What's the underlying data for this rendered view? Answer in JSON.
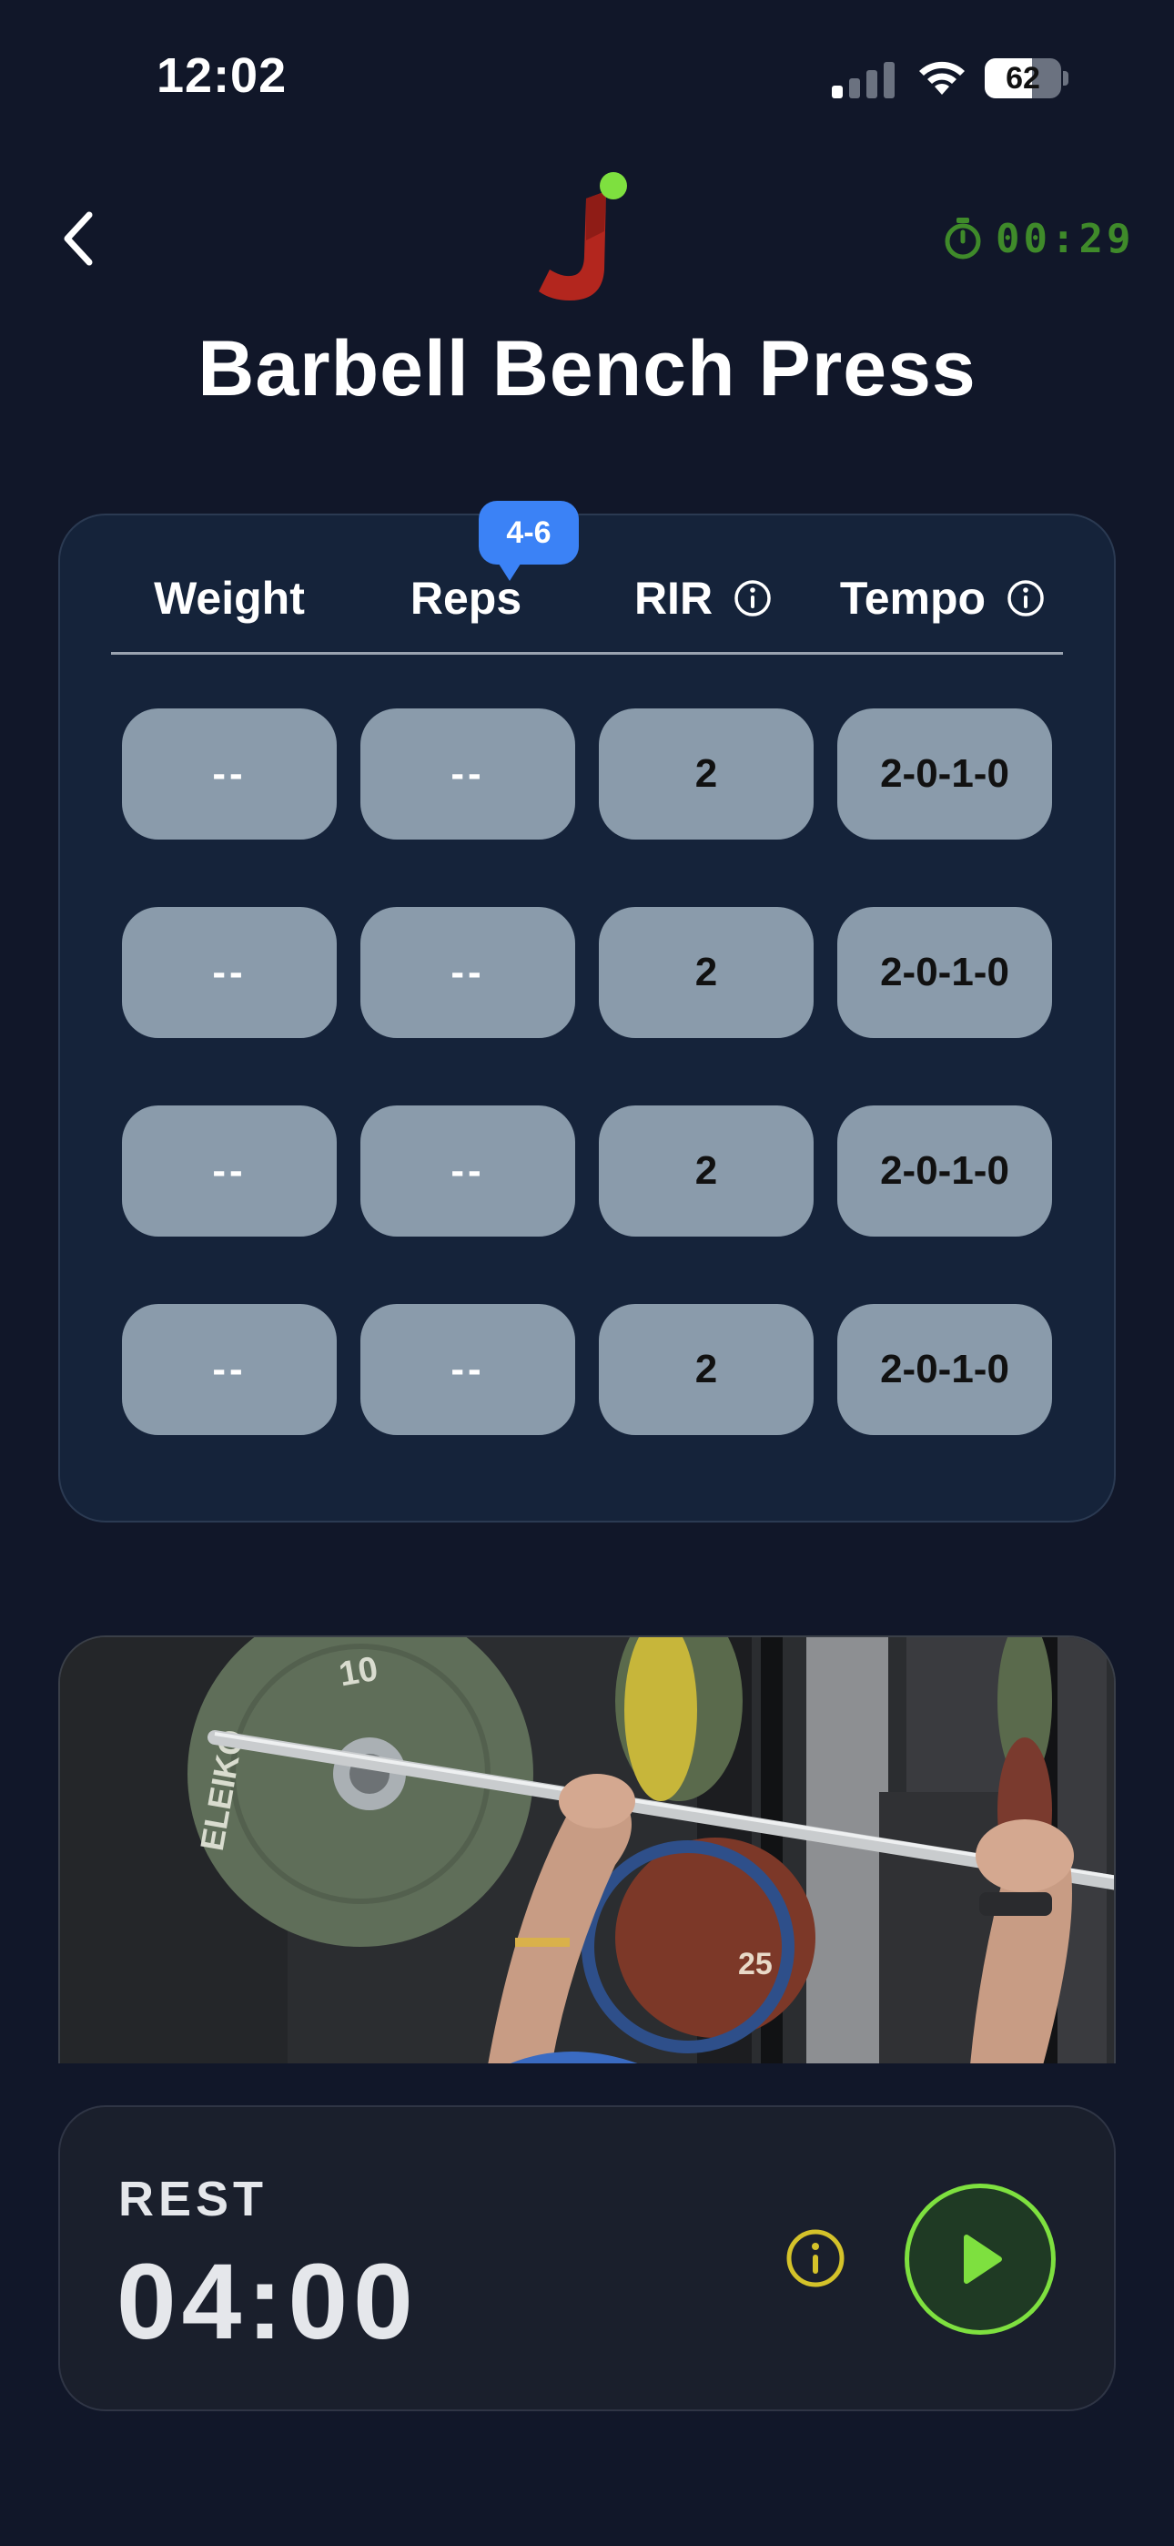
{
  "status_bar": {
    "time": "12:02",
    "battery_percent": "62",
    "battery_level": 0.62,
    "signal_bars_active": 1,
    "signal_bars_total": 4
  },
  "header": {
    "back_icon": "chevron-left-icon",
    "logo_icon": "app-logo-icon",
    "timer_icon": "stopwatch-icon",
    "timer_value": "00:29",
    "timer_color": "#3f8a2a",
    "title": "Barbell Bench Press"
  },
  "sets_table": {
    "columns": [
      {
        "label": "Weight",
        "info": false
      },
      {
        "label": "Reps",
        "info": false
      },
      {
        "label": "RIR",
        "info": true
      },
      {
        "label": "Tempo",
        "info": true
      }
    ],
    "reps_target_badge": "4-6",
    "badge_color": "#3b82f6",
    "rows": [
      {
        "weight": "--",
        "reps": "--",
        "rir": "2",
        "tempo": "2-0-1-0"
      },
      {
        "weight": "--",
        "reps": "--",
        "rir": "2",
        "tempo": "2-0-1-0"
      },
      {
        "weight": "--",
        "reps": "--",
        "rir": "2",
        "tempo": "2-0-1-0"
      },
      {
        "weight": "--",
        "reps": "--",
        "rir": "2",
        "tempo": "2-0-1-0"
      }
    ]
  },
  "video": {
    "plate_label_1": "ELEIKO",
    "plate_label_2": "10",
    "plate_label_3": "25"
  },
  "rest": {
    "label": "REST",
    "time": "04:00",
    "info_icon": "info-icon",
    "info_color": "#d4c22a",
    "play_icon": "play-icon",
    "accent_color": "#7ee03f"
  }
}
